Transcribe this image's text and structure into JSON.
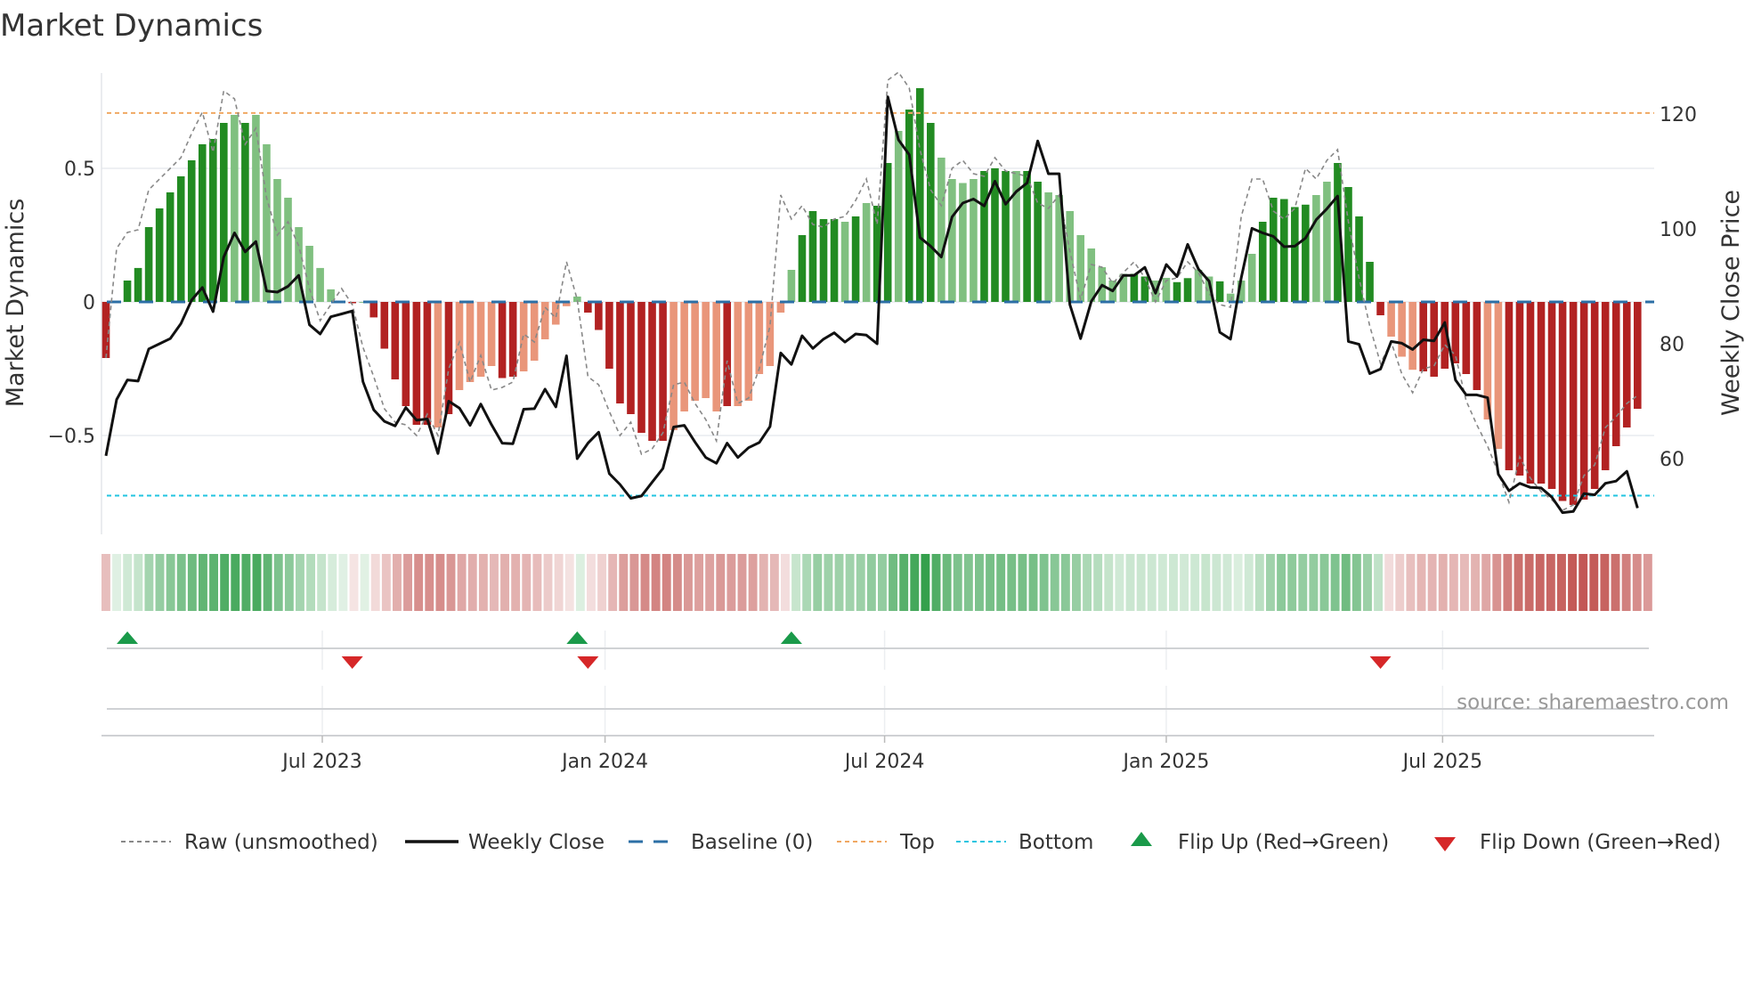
{
  "chart_data": {
    "type": "bar",
    "title": "Market Dynamics",
    "ylabel": "Market Dynamics",
    "y2label": "Weekly Close Price",
    "ylim": [
      -0.85,
      0.88
    ],
    "y2lim": [
      47,
      127
    ],
    "yticks": [
      {
        "v": 0.5,
        "label": "0.5"
      },
      {
        "v": 0,
        "label": "0"
      },
      {
        "v": -0.5,
        "label": "−0.5"
      }
    ],
    "y2ticks": [
      {
        "v": 120,
        "label": "120"
      },
      {
        "v": 100,
        "label": "100"
      },
      {
        "v": 80,
        "label": "80"
      },
      {
        "v": 60,
        "label": "60"
      }
    ],
    "xticks": [
      {
        "week": 20.2,
        "label": "Jul 2023"
      },
      {
        "week": 46.6,
        "label": "Jan 2024"
      },
      {
        "week": 72.7,
        "label": "Jul 2024"
      },
      {
        "week": 99.0,
        "label": "Jan 2025"
      },
      {
        "week": 124.8,
        "label": "Jul 2025"
      }
    ],
    "top_level": 0.707,
    "bottom_level": -0.725,
    "baseline": 0,
    "dynamics": [
      -0.21,
      0.005,
      0.08,
      0.127,
      0.28,
      0.35,
      0.41,
      0.47,
      0.53,
      0.59,
      0.61,
      0.67,
      0.7,
      0.67,
      0.7,
      0.59,
      0.46,
      0.39,
      0.28,
      0.21,
      0.127,
      0.047,
      0.003,
      -0.005,
      0.0,
      -0.058,
      -0.175,
      -0.29,
      -0.39,
      -0.46,
      -0.46,
      -0.47,
      -0.42,
      -0.33,
      -0.3,
      -0.28,
      -0.24,
      -0.285,
      -0.28,
      -0.26,
      -0.22,
      -0.14,
      -0.085,
      -0.016,
      0.02,
      -0.04,
      -0.105,
      -0.25,
      -0.38,
      -0.42,
      -0.49,
      -0.52,
      -0.52,
      -0.48,
      -0.41,
      -0.37,
      -0.36,
      -0.41,
      -0.39,
      -0.39,
      -0.37,
      -0.27,
      -0.24,
      -0.04,
      0.12,
      0.25,
      0.34,
      0.31,
      0.31,
      0.3,
      0.32,
      0.37,
      0.36,
      0.52,
      0.64,
      0.72,
      0.8,
      0.67,
      0.54,
      0.46,
      0.445,
      0.46,
      0.49,
      0.5,
      0.49,
      0.49,
      0.49,
      0.45,
      0.41,
      0.4,
      0.34,
      0.25,
      0.2,
      0.13,
      0.08,
      0.105,
      0.105,
      0.095,
      0.08,
      0.09,
      0.074,
      0.089,
      0.12,
      0.095,
      0.077,
      0.031,
      0.08,
      0.18,
      0.3,
      0.39,
      0.385,
      0.355,
      0.364,
      0.4,
      0.45,
      0.52,
      0.43,
      0.32,
      0.15,
      -0.05,
      -0.13,
      -0.205,
      -0.254,
      -0.26,
      -0.28,
      -0.25,
      -0.23,
      -0.27,
      -0.33,
      -0.44,
      -0.55,
      -0.63,
      -0.65,
      -0.68,
      -0.68,
      -0.7,
      -0.745,
      -0.76,
      -0.74,
      -0.7,
      -0.63,
      -0.54,
      -0.47,
      -0.4
    ],
    "shade": "ddddddddddddldlllllllllddddddddldllllddllllllddddddddllllldllllllddddldlddldddlllldddlddllllllllddllddlldllldddddlldddddlllddddddlldddddddddddddllllll",
    "raw": [
      -0.21,
      0.2,
      0.26,
      0.27,
      0.42,
      0.46,
      0.5,
      0.54,
      0.63,
      0.71,
      0.56,
      0.79,
      0.76,
      0.59,
      0.65,
      0.39,
      0.25,
      0.3,
      0.21,
      0.05,
      -0.07,
      -0.01,
      0.05,
      -0.01,
      -0.17,
      -0.28,
      -0.4,
      -0.45,
      -0.46,
      -0.5,
      -0.42,
      -0.5,
      -0.25,
      -0.15,
      -0.3,
      -0.2,
      -0.33,
      -0.32,
      -0.3,
      -0.12,
      -0.15,
      -0.02,
      -0.06,
      0.15,
      0.01,
      -0.28,
      -0.31,
      -0.41,
      -0.5,
      -0.45,
      -0.57,
      -0.55,
      -0.49,
      -0.31,
      -0.3,
      -0.38,
      -0.44,
      -0.52,
      -0.22,
      -0.38,
      -0.36,
      -0.25,
      -0.09,
      0.4,
      0.31,
      0.36,
      0.29,
      0.28,
      0.31,
      0.32,
      0.38,
      0.46,
      0.29,
      0.83,
      0.86,
      0.8,
      0.57,
      0.42,
      0.36,
      0.5,
      0.53,
      0.48,
      0.47,
      0.54,
      0.49,
      0.48,
      0.47,
      0.37,
      0.35,
      0.4,
      0.19,
      0.01,
      0.14,
      0.13,
      0.07,
      0.11,
      0.15,
      0.09,
      0.0,
      0.08,
      0.09,
      0.15,
      0.11,
      0.03,
      -0.01,
      -0.02,
      0.32,
      0.46,
      0.46,
      0.34,
      0.31,
      0.35,
      0.5,
      0.46,
      0.53,
      0.57,
      0.3,
      0.09,
      -0.09,
      -0.23,
      -0.15,
      -0.27,
      -0.34,
      -0.25,
      -0.24,
      -0.16,
      -0.2,
      -0.37,
      -0.46,
      -0.54,
      -0.64,
      -0.75,
      -0.58,
      -0.66,
      -0.71,
      -0.74,
      -0.78,
      -0.76,
      -0.65,
      -0.61,
      -0.47,
      -0.43,
      -0.38,
      -0.35
    ],
    "close": [
      60.5,
      70.3,
      73.7,
      73.5,
      79.1,
      80.0,
      80.9,
      83.5,
      87.6,
      89.8,
      85.6,
      95.1,
      99.3,
      96.0,
      97.8,
      89.2,
      89.0,
      90.0,
      91.9,
      83.3,
      81.7,
      84.7,
      85.2,
      85.7,
      73.4,
      68.5,
      66.5,
      65.7,
      68.9,
      66.7,
      66.9,
      60.9,
      70.0,
      68.8,
      65.8,
      69.5,
      65.9,
      62.7,
      62.6,
      68.6,
      68.7,
      72.1,
      69.0,
      77.9,
      60.0,
      62.7,
      64.6,
      57.4,
      55.5,
      53.1,
      53.5,
      55.9,
      58.3,
      65.5,
      65.8,
      62.9,
      60.2,
      59.2,
      62.7,
      60.2,
      61.9,
      62.8,
      65.6,
      78.4,
      76.4,
      81.4,
      79.2,
      80.8,
      81.9,
      80.3,
      81.7,
      81.5,
      80.0,
      123.0,
      115.5,
      112.9,
      98.5,
      97.0,
      95.1,
      102.1,
      104.5,
      105.2,
      104.0,
      108.3,
      104.3,
      106.5,
      108.0,
      115.3,
      109.6,
      109.6,
      86.8,
      80.9,
      87.4,
      90.2,
      89.2,
      91.9,
      91.9,
      93.3,
      88.8,
      93.8,
      91.7,
      97.3,
      93.0,
      90.9,
      82.0,
      80.8,
      91.5,
      100.1,
      99.3,
      98.7,
      96.9,
      97.0,
      98.4,
      101.6,
      103.5,
      105.7,
      80.4,
      79.9,
      74.8,
      75.6,
      80.4,
      80.1,
      79.0,
      80.7,
      80.5,
      83.7,
      73.7,
      71.1,
      71.1,
      70.6,
      57.3,
      54.4,
      55.7,
      55.0,
      54.9,
      53.3,
      50.6,
      50.8,
      53.9,
      53.7,
      55.7,
      56.1,
      57.8,
      51.4
    ],
    "flips_up": [
      2,
      44,
      64
    ],
    "flips_down": [
      23,
      45,
      119
    ],
    "legend": {
      "placement": "bottom",
      "raw": "Raw (unsmoothed)",
      "close": "Weekly Close",
      "baseline": "Baseline (0)",
      "top": "Top",
      "bottom": "Bottom",
      "flip_up": "Flip Up (Red→Green)",
      "flip_down": "Flip Down (Green→Red)"
    },
    "source": "source: sharemaestro.com",
    "colors": {
      "green_dark": "#228b22",
      "green_light": "#80c080",
      "red_dark": "#b22222",
      "red_light": "#e9967a",
      "top": "#f0a862",
      "bottom": "#22c4e0",
      "baseline": "#2c6fa6",
      "flip_up": "#1a9a4a",
      "flip_down": "#d62728",
      "close": "#111111",
      "raw": "#888888"
    }
  }
}
